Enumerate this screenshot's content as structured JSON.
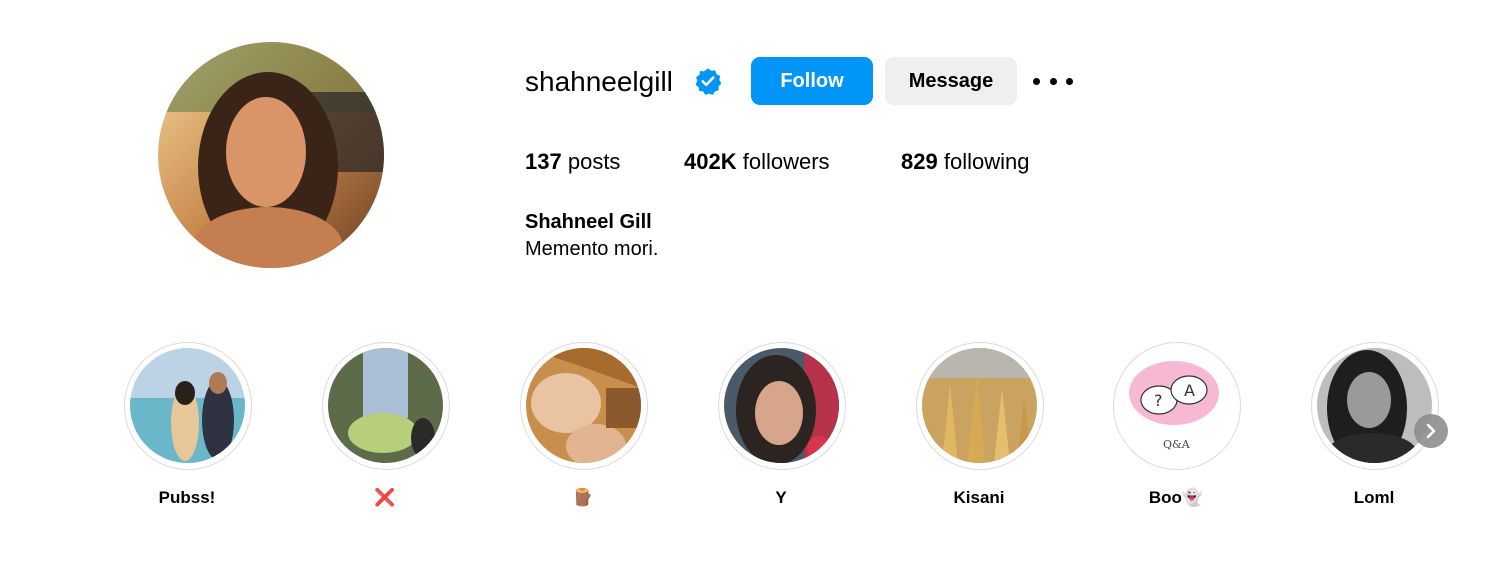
{
  "profile": {
    "username": "shahneelgill",
    "verified": true,
    "follow_label": "Follow",
    "message_label": "Message",
    "stats": {
      "posts_count": "137",
      "posts_label": "posts",
      "followers_count": "402K",
      "followers_label": "followers",
      "following_count": "829",
      "following_label": "following"
    },
    "full_name": "Shahneel Gill",
    "bio": "Memento mori."
  },
  "highlights": [
    {
      "label": "Pubss!"
    },
    {
      "label": "❌"
    },
    {
      "label": "🪵"
    },
    {
      "label": "Y"
    },
    {
      "label": "Kisani"
    },
    {
      "label": "Boo👻"
    },
    {
      "label": "Loml"
    }
  ],
  "colors": {
    "accent": "#0095f6",
    "secondary_button": "#efefef",
    "verified_badge": "#0095f6",
    "ring_border": "#dbdbdb"
  },
  "icons": {
    "verified": "verified-badge-icon",
    "more": "more-options-icon",
    "next": "chevron-right-icon"
  }
}
